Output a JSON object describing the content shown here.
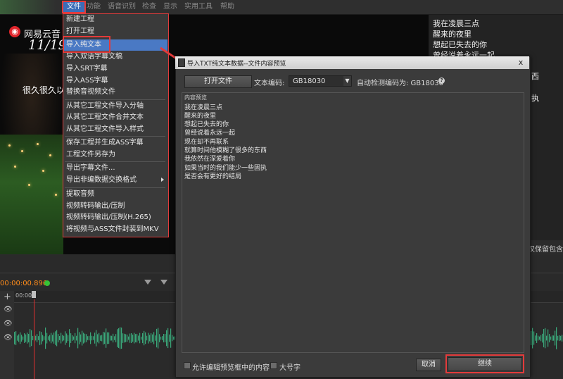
{
  "menubar": {
    "items": [
      "文件",
      "功能",
      "语音识别",
      "检查",
      "显示",
      "实用工具",
      "帮助"
    ]
  },
  "file_menu": {
    "items": [
      "新建工程",
      "打开工程",
      "导入纯文本",
      "导入双语字幕文稿",
      "导入SRT字幕",
      "导入ASS字幕",
      "替换音视频文件",
      "从其它工程文件导入分轴",
      "从其它工程文件合并文本",
      "从其它工程文件导入样式",
      "保存工程并生成ASS字幕",
      "工程文件另存为",
      "导出字幕文件...",
      "导出非编数据交换格式",
      "提取音频",
      "视频转码输出/压制",
      "视频转码输出/压制(H.265)",
      "将视频与ASS文件封装到MKV"
    ]
  },
  "video": {
    "brand_icon": "◉",
    "brand": "网易云音",
    "date": "11/19",
    "subtitle": "很久很久以"
  },
  "lyrics_column": {
    "lines": [
      "我在凌晨三点",
      "醒来的夜里",
      "想起已失去的你",
      "曾经说着永远一起"
    ],
    "partial": [
      "西",
      "执"
    ],
    "footer_note": "仅保留包含"
  },
  "timeline": {
    "timecode": "00:00:00.896",
    "ruler_start": "00:00",
    "plus": "+",
    "eye_icon": "👁"
  },
  "dialog": {
    "title": "导入TXT纯文本数据--文件内容预览",
    "close": "x",
    "open_file_button": "打开文件",
    "encoding_label": "文本编码:",
    "encoding_value": "GB18030",
    "encoding_arrow": "▼",
    "auto_detect_label": "自动检测编码为: GB18030",
    "help": "?",
    "preview_caption": "内容预览",
    "preview_lines": [
      "我在凌晨三点",
      "醒来的夜里",
      "想起已失去的你",
      "曾经说着永远一起",
      "现在却不再联系",
      "就算时间他模糊了很多的东西",
      "我依然在深爱着你",
      "如果当时的我们能少一些固执",
      "是否会有更好的结局"
    ],
    "allow_edit_label": "允许编辑预览框中的内容",
    "large_font_label": "大号字",
    "cancel_button": "取消",
    "continue_button": "继续"
  },
  "colors": {
    "highlight_border": "#e33b3b",
    "menu_selected": "#4a79c4",
    "timecode": "#ff8c1a",
    "waveform": "#3aa87a"
  }
}
